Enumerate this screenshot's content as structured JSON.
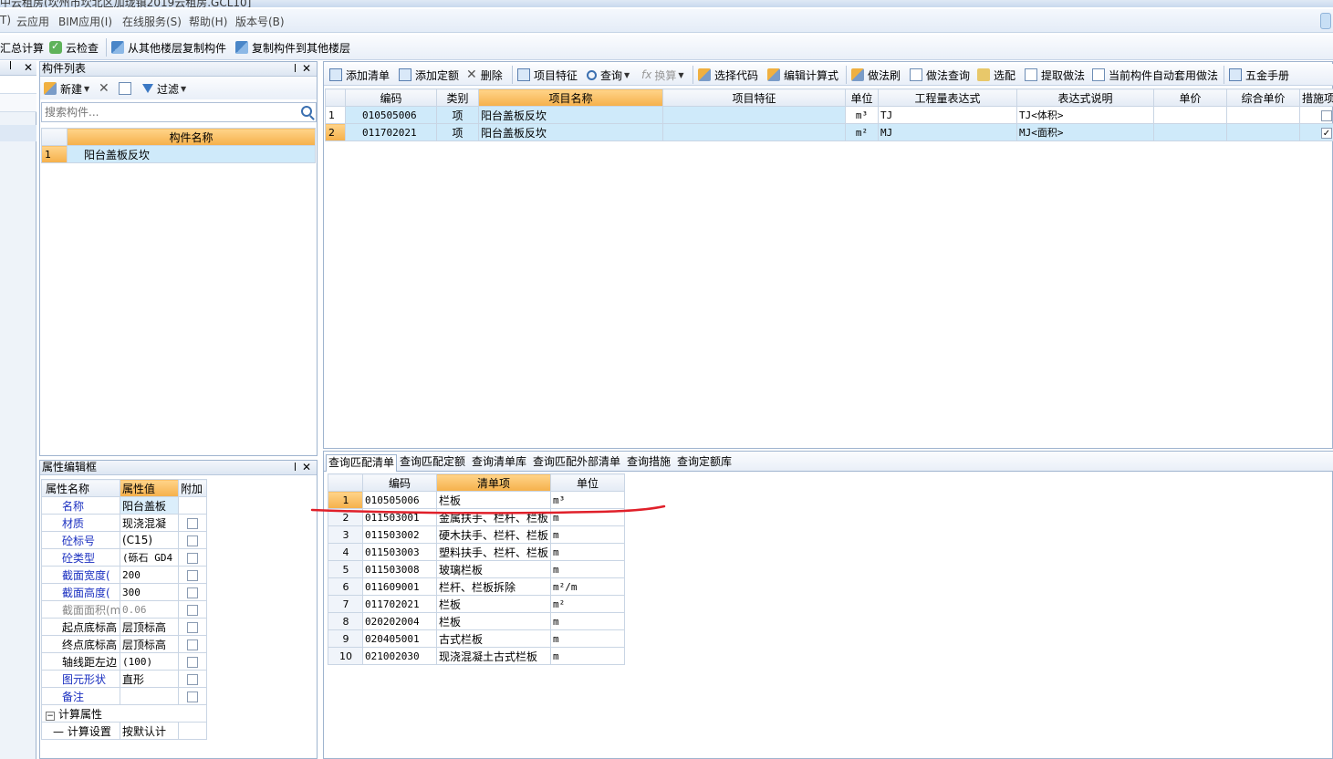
{
  "title_fragment": "中云租房(坎州市坎北区加珑镇2019云租房.GCL10]",
  "menu": [
    "T)",
    "云应用",
    "BIM应用(I)",
    "在线服务(S)",
    "帮助(H)",
    "版本号(B)"
  ],
  "toolbar1": {
    "summary_calc": "汇总计算",
    "cloud_check": "云检查",
    "copy_from_floor": "从其他楼层复制构件",
    "copy_to_floor": "复制构件到其他楼层"
  },
  "component_list": {
    "title": "构件列表",
    "new_label": "新建",
    "filter_label": "过滤",
    "search_placeholder": "搜索构件...",
    "header": "构件名称",
    "rows": [
      {
        "num": "1",
        "name": "阳台盖板反坎"
      }
    ]
  },
  "property_box": {
    "title": "属性编辑框",
    "headers": [
      "属性名称",
      "属性值",
      "附加"
    ],
    "rows": [
      {
        "name": "名称",
        "value": "阳台盖板",
        "style": "blue",
        "checkbox": false,
        "has_checkbox": false
      },
      {
        "name": "材质",
        "value": "现浇混凝",
        "style": "blue",
        "checkbox": false,
        "has_checkbox": true
      },
      {
        "name": "砼标号",
        "value": "(C15)",
        "style": "blue",
        "checkbox": false,
        "has_checkbox": true
      },
      {
        "name": "砼类型",
        "value": "(砾石 GD4",
        "style": "blue",
        "checkbox": false,
        "has_checkbox": true
      },
      {
        "name": "截面宽度(",
        "value": "200",
        "style": "blue",
        "checkbox": false,
        "has_checkbox": true
      },
      {
        "name": "截面高度(",
        "value": "300",
        "style": "blue",
        "checkbox": false,
        "has_checkbox": true
      },
      {
        "name": "截面面积(m",
        "value": "0.06",
        "style": "gray",
        "checkbox": false,
        "has_checkbox": true
      },
      {
        "name": "起点底标高",
        "value": "层顶标高",
        "style": "black",
        "checkbox": false,
        "has_checkbox": true
      },
      {
        "name": "终点底标高",
        "value": "层顶标高",
        "style": "black",
        "checkbox": false,
        "has_checkbox": true
      },
      {
        "name": "轴线距左边",
        "value": "(100)",
        "style": "black",
        "checkbox": false,
        "has_checkbox": true
      },
      {
        "name": "图元形状",
        "value": "直形",
        "style": "blue",
        "checkbox": false,
        "has_checkbox": true
      },
      {
        "name": "备注",
        "value": "",
        "style": "blue",
        "checkbox": false,
        "has_checkbox": true
      }
    ],
    "group_label": "计算属性",
    "group_child": "计算设置",
    "group_child_value": "按默认计"
  },
  "right_toolbar": {
    "add_list": "添加清单",
    "add_quota": "添加定额",
    "delete": "删除",
    "item_feature": "项目特征",
    "query": "查询",
    "convert": "换算",
    "select_code": "选择代码",
    "edit_formula": "编辑计算式",
    "method_brush": "做法刷",
    "method_query": "做法查询",
    "match": "选配",
    "extract_method": "提取做法",
    "auto_apply": "当前构件自动套用做法",
    "hardware_manual": "五金手册"
  },
  "main_table": {
    "headers": [
      "编码",
      "类别",
      "项目名称",
      "项目特征",
      "单位",
      "工程量表达式",
      "表达式说明",
      "单价",
      "综合单价",
      "措施项"
    ],
    "rows": [
      {
        "num": "1",
        "code": "010505006",
        "type": "项",
        "name": "阳台盖板反坎",
        "feature": "",
        "unit": "m³",
        "expr": "TJ",
        "desc": "TJ<体积>",
        "price": "",
        "total": "",
        "measure": false
      },
      {
        "num": "2",
        "code": "011702021",
        "type": "项",
        "name": "阳台盖板反坎",
        "feature": "",
        "unit": "m²",
        "expr": "MJ",
        "desc": "MJ<面积>",
        "price": "",
        "total": "",
        "measure": true
      }
    ]
  },
  "bottom_tabs": [
    "查询匹配清单",
    "查询匹配定额",
    "查询清单库",
    "查询匹配外部清单",
    "查询措施",
    "查询定额库"
  ],
  "match_table": {
    "headers": [
      "编码",
      "清单项",
      "单位"
    ],
    "rows": [
      {
        "num": "1",
        "code": "010505006",
        "item": "栏板",
        "unit": "m³"
      },
      {
        "num": "2",
        "code": "011503001",
        "item": "金属扶手、栏杆、栏板",
        "unit": "m"
      },
      {
        "num": "3",
        "code": "011503002",
        "item": "硬木扶手、栏杆、栏板",
        "unit": "m"
      },
      {
        "num": "4",
        "code": "011503003",
        "item": "塑料扶手、栏杆、栏板",
        "unit": "m"
      },
      {
        "num": "5",
        "code": "011503008",
        "item": "玻璃栏板",
        "unit": "m"
      },
      {
        "num": "6",
        "code": "011609001",
        "item": "栏杆、栏板拆除",
        "unit": "m²/m"
      },
      {
        "num": "7",
        "code": "011702021",
        "item": "栏板",
        "unit": "m²"
      },
      {
        "num": "8",
        "code": "020202004",
        "item": "栏板",
        "unit": "m"
      },
      {
        "num": "9",
        "code": "020405001",
        "item": "古式栏板",
        "unit": "m"
      },
      {
        "num": "10",
        "code": "021002030",
        "item": "现浇混凝土古式栏板",
        "unit": "m"
      }
    ]
  },
  "colors": {
    "accent_header": "#f5b04a",
    "row_highlight": "#cfeafa",
    "annotation": "#e0202a"
  }
}
